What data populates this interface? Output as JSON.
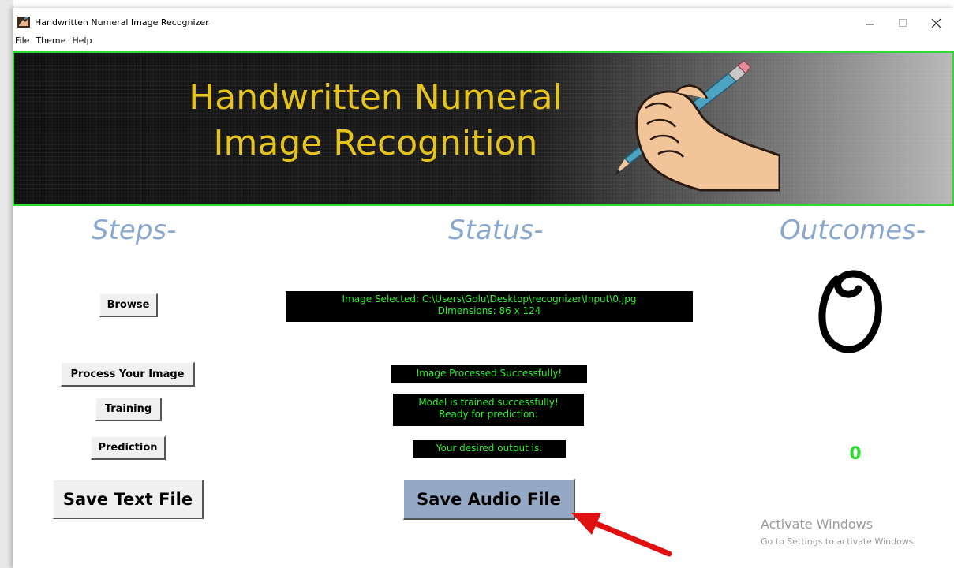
{
  "window": {
    "title": "Handwritten Numeral Image Recognizer",
    "minimize_icon": "minimize-icon",
    "maximize_icon": "maximize-icon",
    "close_icon": "close-icon"
  },
  "menu": {
    "items": [
      "File",
      "Theme",
      "Help"
    ]
  },
  "banner": {
    "line1": "Handwritten Numeral",
    "line2": "Image Recognition",
    "title_color": "#e6c41c",
    "border_color": "#2fd92f"
  },
  "headings": {
    "steps": "Steps-",
    "status": "Status-",
    "outcomes": "Outcomes-",
    "color": "#8aa8cf"
  },
  "steps": {
    "browse": "Browse",
    "process": "Process Your Image",
    "training": "Training",
    "prediction": "Prediction",
    "save_text": "Save Text File",
    "save_audio": "Save Audio File"
  },
  "status": {
    "image_selected_line1": "Image Selected: C:\\Users\\Golu\\Desktop\\recognizer\\Input\\0.jpg",
    "image_selected_line2": "Dimensions: 86 x 124",
    "processed": "Image Processed Successfully!",
    "trained_line1": "Model is trained successfully!",
    "trained_line2": "Ready for prediction.",
    "output": "Your desired output is:",
    "text_color": "#2cf02c"
  },
  "outcomes": {
    "input_digit_image": "handwritten digit 0",
    "predicted_value": "0"
  },
  "watermark": {
    "line1": "Activate Windows",
    "line2": "Go to Settings to activate Windows."
  }
}
